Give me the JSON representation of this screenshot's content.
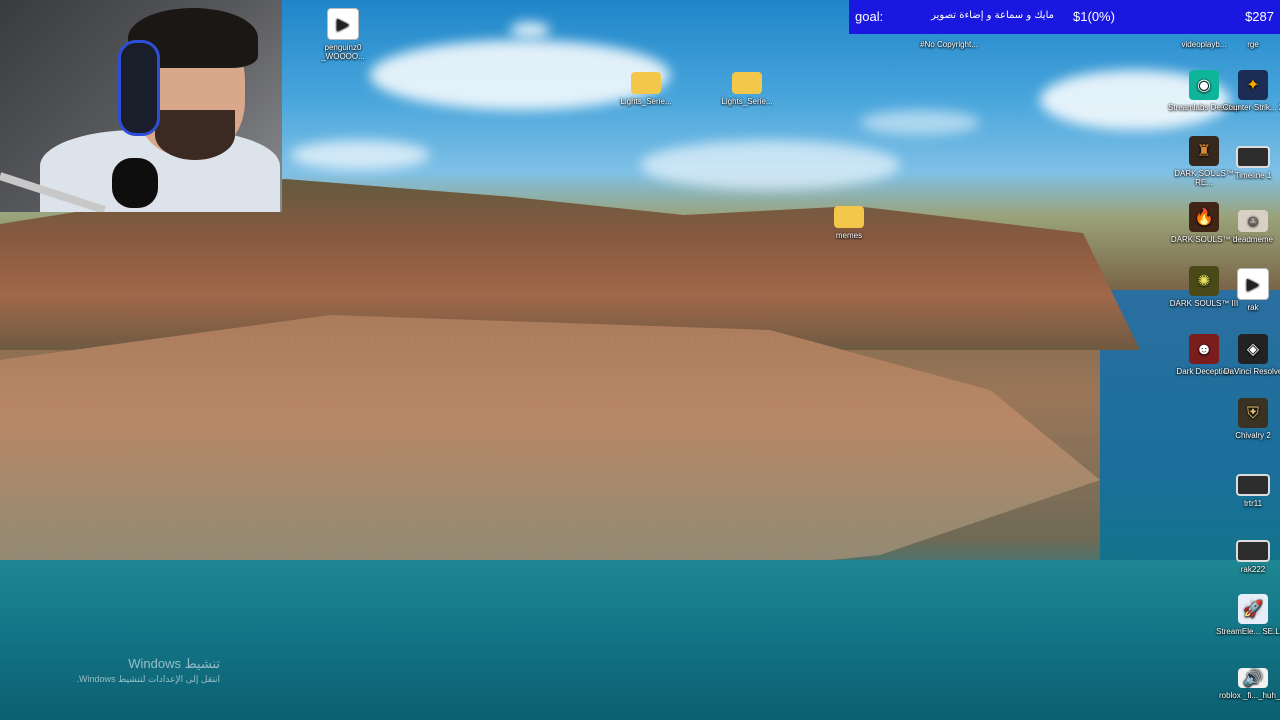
{
  "goal_bar": {
    "label": "goal:",
    "text": "مايك و سماعة و إضاءة تصوير",
    "amount": "$1(0%)",
    "total": "$287"
  },
  "desktop_icons": [
    {
      "name": "penguinz0-file",
      "label": "penguinz0 _WOOOO...",
      "icon": "play-file-icon"
    },
    {
      "name": "folder-lights-1",
      "label": "Lights_Serie...",
      "icon": "folder-icon"
    },
    {
      "name": "folder-lights-2",
      "label": "Lights_Serie...",
      "icon": "folder-icon"
    },
    {
      "name": "no-copyright-file",
      "label": "#No Copyright...",
      "icon": "file-icon"
    },
    {
      "name": "videoplayb-file",
      "label": "videoplayb...",
      "icon": "video-icon"
    },
    {
      "name": "rge-file",
      "label": "rge",
      "icon": "file-icon"
    },
    {
      "name": "memes-folder",
      "label": "memes",
      "icon": "folder-icon"
    },
    {
      "name": "streamlabs-desktop",
      "label": "Streamlabs Desktop",
      "icon": "streamlabs-icon"
    },
    {
      "name": "counter-strike-2",
      "label": "Counter-Strik... 2",
      "icon": "counter-strike-icon"
    },
    {
      "name": "dark-souls-re",
      "label": "DARK SOULS™ RE...",
      "icon": "dark-souls-icon"
    },
    {
      "name": "timeline-1",
      "label": "Timeline 1",
      "icon": "video-icon"
    },
    {
      "name": "dark-souls-ii",
      "label": "DARK SOULS™ II",
      "icon": "dark-souls-icon"
    },
    {
      "name": "deadmeme",
      "label": "deadmeme",
      "icon": "image-icon"
    },
    {
      "name": "dark-souls-iii",
      "label": "DARK SOULS™ III",
      "icon": "dark-souls-icon"
    },
    {
      "name": "rak-file",
      "label": "rak",
      "icon": "play-file-icon"
    },
    {
      "name": "dark-deception",
      "label": "Dark Deception",
      "icon": "dark-deception-icon"
    },
    {
      "name": "davinci-resolve",
      "label": "DaVinci Resolve",
      "icon": "davinci-icon"
    },
    {
      "name": "chivalry-2",
      "label": "Chivalry 2",
      "icon": "shield-icon"
    },
    {
      "name": "trtr11",
      "label": "trtr11",
      "icon": "video-icon"
    },
    {
      "name": "rak222",
      "label": "rak222",
      "icon": "video-icon"
    },
    {
      "name": "streamelements",
      "label": "StreamEle... SE.Live",
      "icon": "rocket-icon"
    },
    {
      "name": "roblox-huh",
      "label": "roblox _fi..._huh_...",
      "icon": "speaker-icon"
    }
  ],
  "activation": {
    "title": "تنشيط Windows",
    "subtitle": "انتقل إلى الإعدادات لتنشيط Windows."
  }
}
